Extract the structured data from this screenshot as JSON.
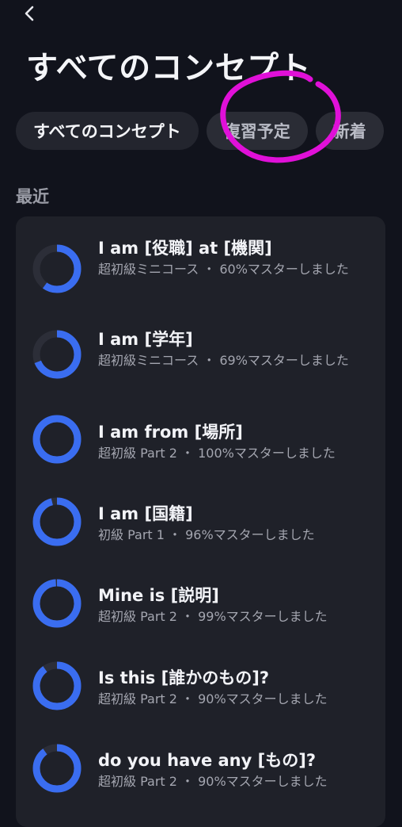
{
  "header": {
    "title": "すべてのコンセプト"
  },
  "tabs": [
    {
      "label": "すべてのコンセプト"
    },
    {
      "label": "復習予定"
    },
    {
      "label": "新着"
    }
  ],
  "section": {
    "label": "最近"
  },
  "concepts": [
    {
      "title": "I am [役職] at [機関]",
      "subtitle": "超初級ミニコース ・ 60%マスターしました",
      "mastery": 60
    },
    {
      "title": "I am [学年]",
      "subtitle": "超初級ミニコース ・ 69%マスターしました",
      "mastery": 69
    },
    {
      "title": "I am from [場所]",
      "subtitle": "超初級 Part 2 ・ 100%マスターしました",
      "mastery": 100
    },
    {
      "title": "I am [国籍]",
      "subtitle": "初級 Part 1 ・ 96%マスターしました",
      "mastery": 96
    },
    {
      "title": "Mine is [説明]",
      "subtitle": "超初級 Part 2 ・ 99%マスターしました",
      "mastery": 99
    },
    {
      "title": "Is this [誰かのもの]?",
      "subtitle": "超初級 Part 2 ・ 90%マスターしました",
      "mastery": 90
    },
    {
      "title": "do you have any [もの]?",
      "subtitle": "超初級 Part 2 ・ 90%マスターしました",
      "mastery": 90
    }
  ],
  "colors": {
    "ring_progress": "#3a6df0",
    "ring_track": "#2c2e38",
    "annotation": "#e010d8"
  }
}
